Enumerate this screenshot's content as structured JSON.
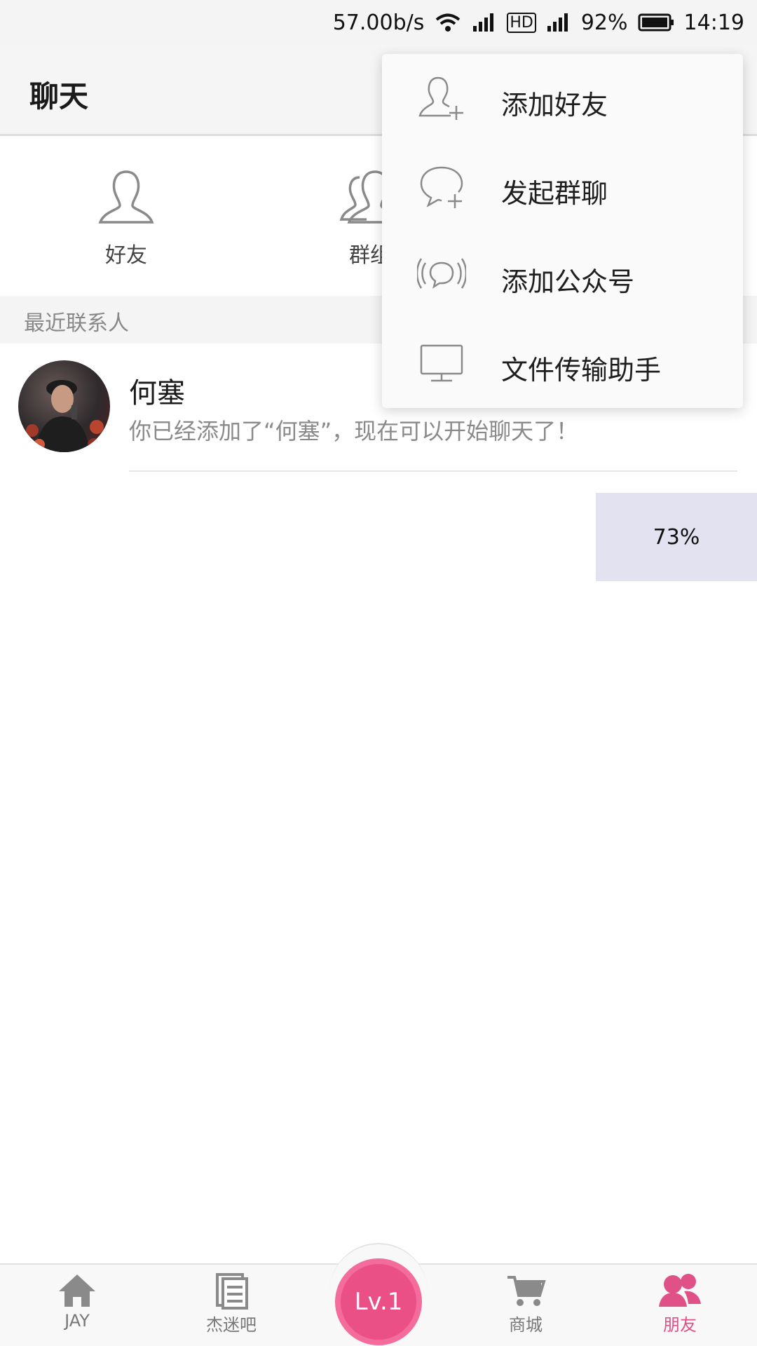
{
  "status_bar": {
    "net_speed": "57.00b/s",
    "hd_label": "HD",
    "battery": "92%",
    "time": "14:19"
  },
  "header": {
    "title": "聊天"
  },
  "quick_entries": [
    {
      "label": "好友",
      "icon": "person-icon"
    },
    {
      "label": "群组",
      "icon": "group-icon"
    }
  ],
  "section": {
    "label": "最近联系人"
  },
  "contacts": [
    {
      "name": "何塞",
      "message": "你已经添加了“何塞”，现在可以开始聊天了！"
    }
  ],
  "progress_badge": {
    "value": "73%"
  },
  "menu": {
    "items": [
      {
        "label": "添加好友",
        "icon": "add-friend-icon"
      },
      {
        "label": "发起群聊",
        "icon": "group-chat-icon"
      },
      {
        "label": "添加公众号",
        "icon": "broadcast-icon"
      },
      {
        "label": "文件传输助手",
        "icon": "monitor-icon"
      }
    ]
  },
  "bottom_nav": {
    "items": [
      {
        "label": "JAY",
        "icon": "home-icon"
      },
      {
        "label": "杰迷吧",
        "icon": "document-icon"
      },
      {
        "label": "商城",
        "icon": "cart-icon"
      },
      {
        "label": "朋友",
        "icon": "friends-icon"
      }
    ],
    "center_label": "Lv.1",
    "active": "朋友",
    "accent": "#e05188"
  },
  "colors": {
    "accent": "#e05188",
    "header_bg": "#f5f5f5",
    "menu_bg": "#fafafa",
    "progress_bg": "#e2e2f0"
  }
}
